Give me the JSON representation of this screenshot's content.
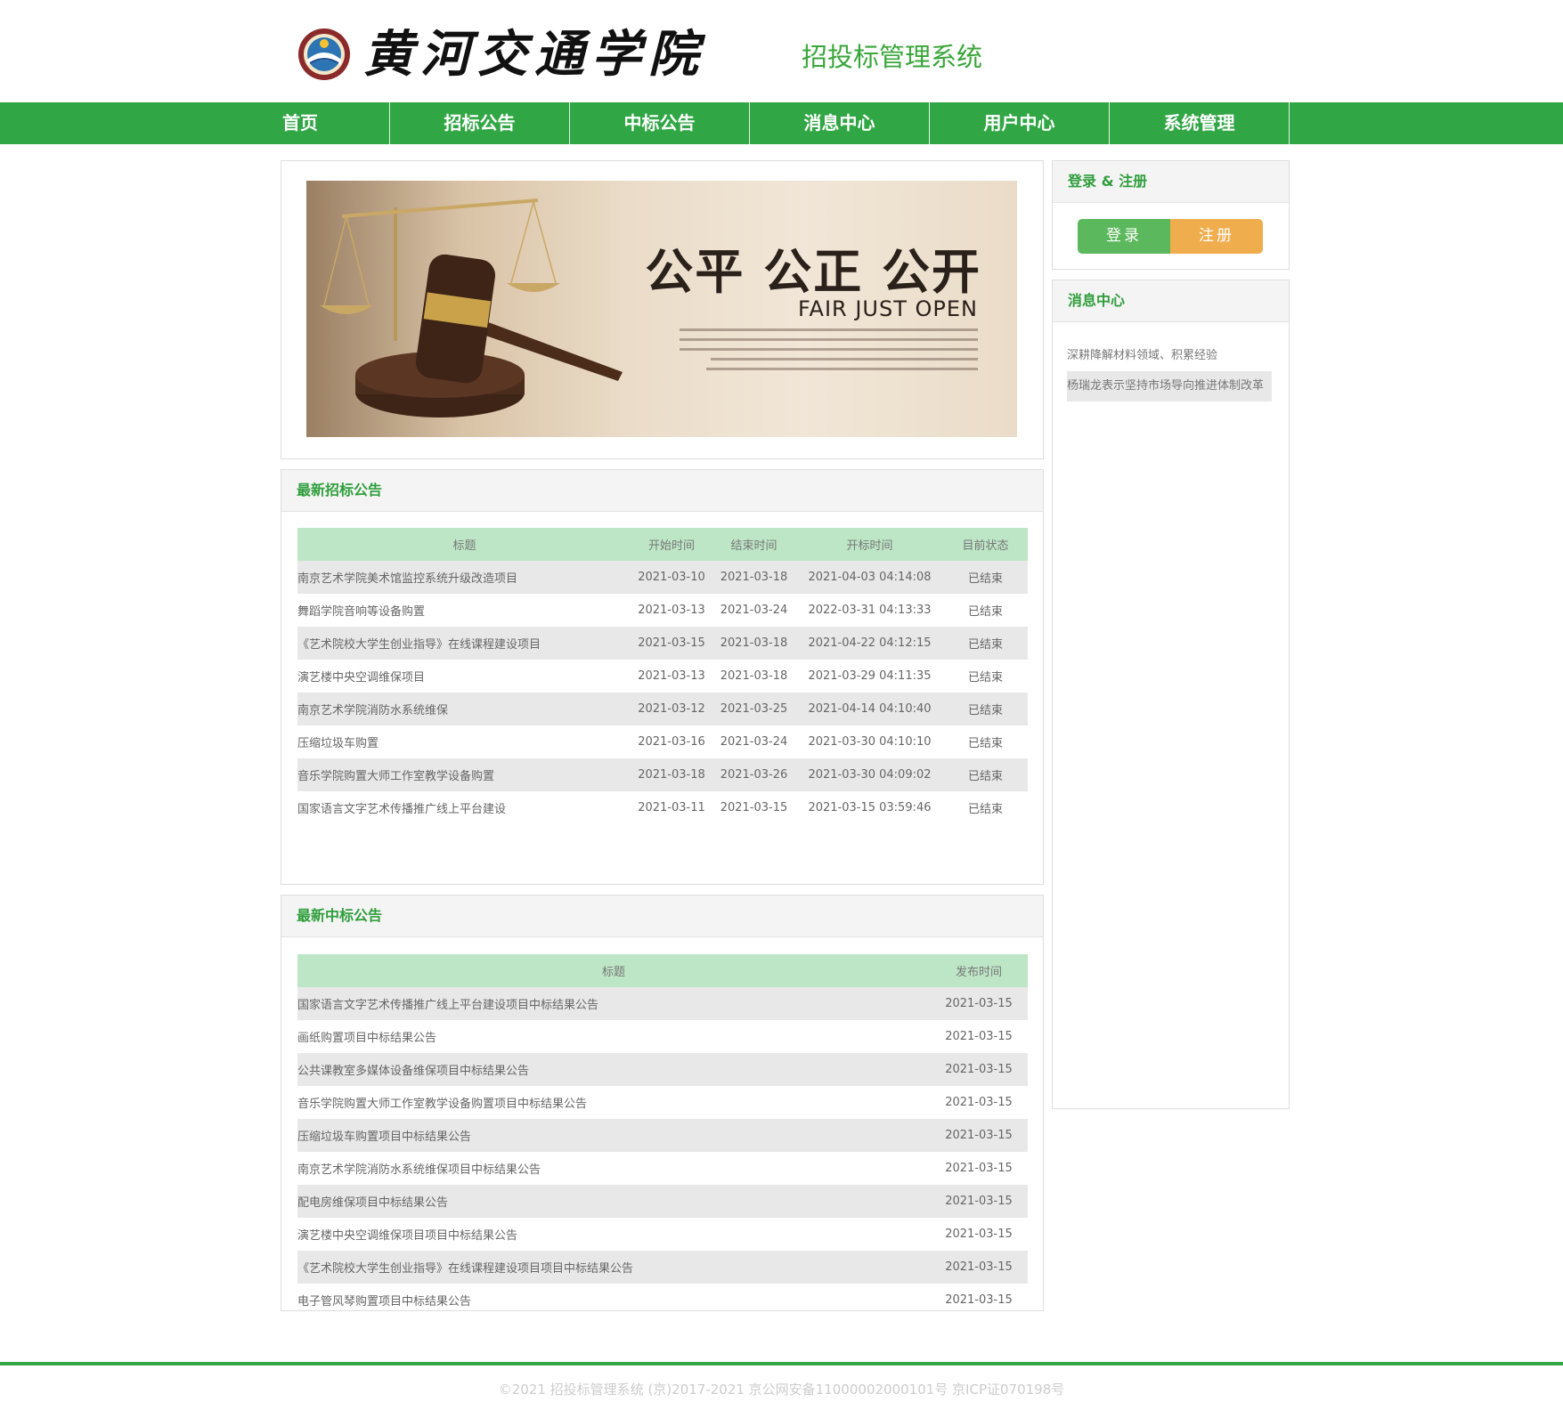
{
  "header": {
    "logo_text": "黄河交通学院",
    "system_title": "招投标管理系统"
  },
  "nav": {
    "items": [
      {
        "label": "首页"
      },
      {
        "label": "招标公告"
      },
      {
        "label": "中标公告"
      },
      {
        "label": "消息中心"
      },
      {
        "label": "用户中心"
      },
      {
        "label": "系统管理"
      }
    ],
    "color": "#31a645"
  },
  "banner": {
    "title": "公平 公正 公开",
    "subtitle": "FAIR JUST OPEN"
  },
  "tender": {
    "heading": "最新招标公告",
    "columns": [
      "标题",
      "开始时间",
      "结束时间",
      "开标时间",
      "目前状态"
    ],
    "rows": [
      [
        "南京艺术学院美术馆监控系统升级改造项目",
        "2021-03-10",
        "2021-03-18",
        "2021-04-03 04:14:08",
        "已结束"
      ],
      [
        "舞蹈学院音响等设备购置",
        "2021-03-13",
        "2021-03-24",
        "2022-03-31 04:13:33",
        "已结束"
      ],
      [
        "《艺术院校大学生创业指导》在线课程建设项目",
        "2021-03-15",
        "2021-03-18",
        "2021-04-22 04:12:15",
        "已结束"
      ],
      [
        "演艺楼中央空调维保项目",
        "2021-03-13",
        "2021-03-18",
        "2021-03-29 04:11:35",
        "已结束"
      ],
      [
        "南京艺术学院消防水系统维保",
        "2021-03-12",
        "2021-03-25",
        "2021-04-14 04:10:40",
        "已结束"
      ],
      [
        "压缩垃圾车购置",
        "2021-03-16",
        "2021-03-24",
        "2021-03-30 04:10:10",
        "已结束"
      ],
      [
        "音乐学院购置大师工作室教学设备购置",
        "2021-03-18",
        "2021-03-26",
        "2021-03-30 04:09:02",
        "已结束"
      ],
      [
        "国家语言文字艺术传播推广线上平台建设",
        "2021-03-11",
        "2021-03-15",
        "2021-03-15 03:59:46",
        "已结束"
      ]
    ]
  },
  "award": {
    "heading": "最新中标公告",
    "columns": [
      "标题",
      "发布时间"
    ],
    "rows": [
      [
        "国家语言文字艺术传播推广线上平台建设项目中标结果公告",
        "2021-03-15"
      ],
      [
        "画纸购置项目中标结果公告",
        "2021-03-15"
      ],
      [
        "公共课教室多媒体设备维保项目中标结果公告",
        "2021-03-15"
      ],
      [
        "音乐学院购置大师工作室教学设备购置项目中标结果公告",
        "2021-03-15"
      ],
      [
        "压缩垃圾车购置项目中标结果公告",
        "2021-03-15"
      ],
      [
        "南京艺术学院消防水系统维保项目中标结果公告",
        "2021-03-15"
      ],
      [
        "配电房维保项目中标结果公告",
        "2021-03-15"
      ],
      [
        "演艺楼中央空调维保项目项目中标结果公告",
        "2021-03-15"
      ],
      [
        "《艺术院校大学生创业指导》在线课程建设项目项目中标结果公告",
        "2021-03-15"
      ],
      [
        "电子管风琴购置项目中标结果公告",
        "2021-03-15"
      ]
    ]
  },
  "auth": {
    "heading": "登录 & 注册",
    "login_label": "登录",
    "register_label": "注册",
    "login_color": "#5cb85c",
    "register_color": "#f0ad4e"
  },
  "messages": {
    "heading": "消息中心",
    "items": [
      "深耕降解材料领域、积累经验",
      "杨瑞龙表示坚持市场导向推进体制改革"
    ]
  },
  "footer": {
    "text": "©2021 招投标管理系统 (京)2017-2021 京公网安备11000002000101号 京ICP证070198号"
  }
}
